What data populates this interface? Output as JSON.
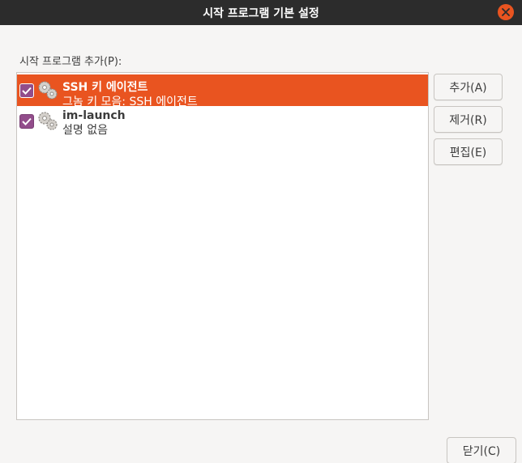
{
  "window": {
    "title": "시작 프로그램 기본 설정"
  },
  "section_label": "시작 프로그램 추가(P):",
  "programs": [
    {
      "name": "SSH 키 에이전트",
      "description": "그놈 키 모음: SSH 에이전트",
      "enabled": true,
      "selected": true
    },
    {
      "name": "im-launch",
      "description": "설명 없음",
      "enabled": true,
      "selected": false
    }
  ],
  "buttons": {
    "add": "추가(A)",
    "remove": "제거(R)",
    "edit": "편집(E)",
    "close": "닫기(C)"
  },
  "colors": {
    "selection": "#e95420",
    "checkbox": "#924d8b",
    "titlebar": "#2c2c2c"
  }
}
